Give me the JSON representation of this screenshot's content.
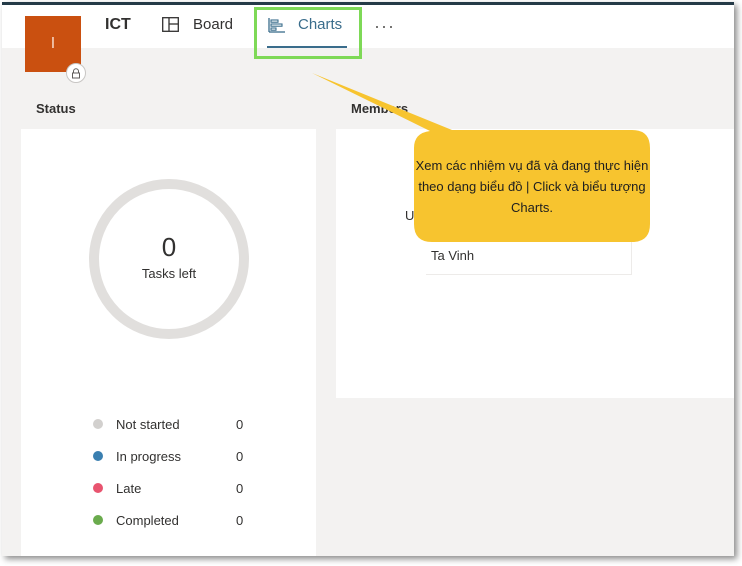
{
  "header": {
    "avatar_letter": "I",
    "plan_title": "ICT",
    "tabs": [
      {
        "label": "Board",
        "icon": "board-icon",
        "selected": false
      },
      {
        "label": "Charts",
        "icon": "chart-icon",
        "selected": true
      }
    ],
    "more_label": "···"
  },
  "status": {
    "title": "Status",
    "count": "0",
    "count_label": "Tasks left",
    "legend": [
      {
        "label": "Not started",
        "value": "0",
        "color": "#d2d0ce"
      },
      {
        "label": "In progress",
        "value": "0",
        "color": "#3a7fb0"
      },
      {
        "label": "Late",
        "value": "0",
        "color": "#e8546f"
      },
      {
        "label": "Completed",
        "value": "0",
        "color": "#6aab4d"
      }
    ]
  },
  "members": {
    "title": "Members",
    "initial": "U",
    "name": "Ta Vinh"
  },
  "callout": {
    "text": "Xem các nhiệm vụ đã và đang thực hiện theo dạng biểu đồ | Click và biểu tượng Charts.",
    "color": "#f7c42f"
  },
  "colors": {
    "accent": "#3a6d8c",
    "avatar": "#ca5010",
    "highlight": "#7ed957"
  }
}
